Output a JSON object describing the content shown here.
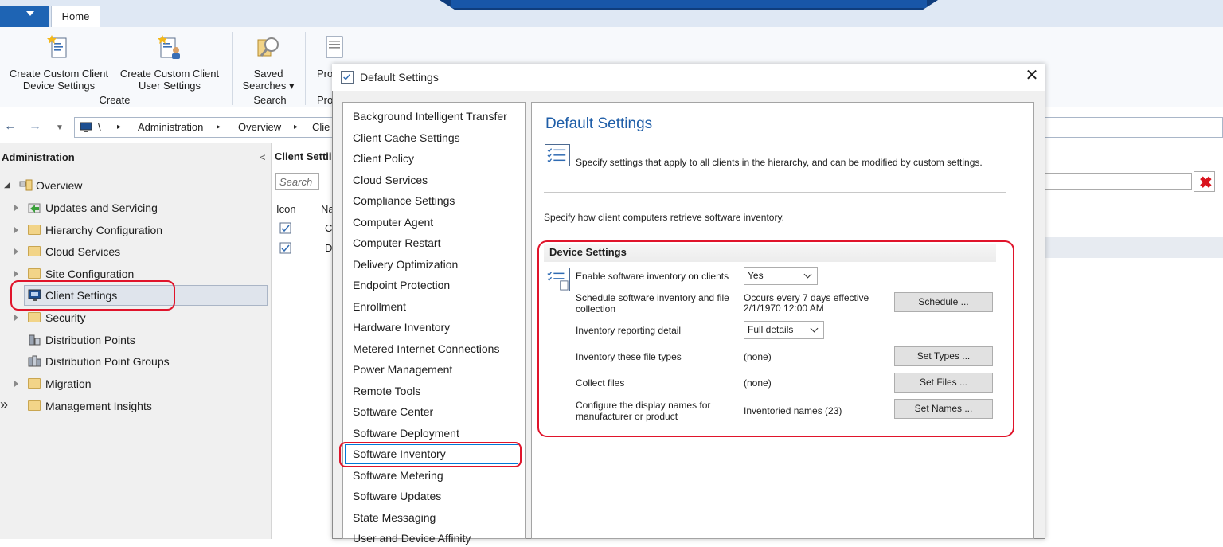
{
  "ribbon": {
    "tab_home": "Home",
    "btn_create_device": [
      "Create Custom Client",
      "Device Settings"
    ],
    "btn_create_user": [
      "Create Custom Client",
      "User Settings"
    ],
    "btn_saved_searches": [
      "Saved",
      "Searches ▾"
    ],
    "btn_pro": "Pro",
    "group_create": "Create",
    "group_search": "Search",
    "group_pro": "Pro"
  },
  "addressbar": {
    "crumbs": [
      "\\",
      "▸",
      "Administration",
      "▸",
      "Overview",
      "▸",
      "Clie"
    ]
  },
  "nav": {
    "title": "Administration",
    "collapse_glyph": "<",
    "items": [
      {
        "label": "Overview",
        "icon": "overview-icon"
      },
      {
        "label": "Updates and Servicing",
        "icon": "updates-icon"
      },
      {
        "label": "Hierarchy Configuration",
        "icon": "folder-icon"
      },
      {
        "label": "Cloud Services",
        "icon": "folder-icon"
      },
      {
        "label": "Site Configuration",
        "icon": "folder-icon"
      },
      {
        "label": "Client Settings",
        "icon": "client-settings-icon"
      },
      {
        "label": "Security",
        "icon": "folder-icon"
      },
      {
        "label": "Distribution Points",
        "icon": "distribution-point-icon"
      },
      {
        "label": "Distribution Point Groups",
        "icon": "distribution-point-group-icon"
      },
      {
        "label": "Migration",
        "icon": "folder-icon"
      },
      {
        "label": "Management Insights",
        "icon": "folder-icon"
      }
    ],
    "expand_glyph": "»"
  },
  "list": {
    "title": "Client Settii",
    "search_placeholder": "Search",
    "col_icon": "Icon",
    "col_name": "Na",
    "rows": [
      {
        "name": "C"
      },
      {
        "name": "D"
      }
    ]
  },
  "dialog": {
    "title": "Default Settings",
    "close_glyph": "✕",
    "categories": [
      "Background Intelligent Transfer",
      "Client Cache Settings",
      "Client Policy",
      "Cloud Services",
      "Compliance Settings",
      "Computer Agent",
      "Computer Restart",
      "Delivery Optimization",
      "Endpoint Protection",
      "Enrollment",
      "Hardware Inventory",
      "Metered Internet Connections",
      "Power Management",
      "Remote Tools",
      "Software Center",
      "Software Deployment",
      "Software Inventory",
      "Software Metering",
      "Software Updates",
      "State Messaging",
      "User and Device Affinity"
    ],
    "selected_category": "Software Inventory",
    "panel": {
      "title": "Default Settings",
      "description": "Specify settings that apply to all clients in the hierarchy, and can be modified by custom settings.",
      "intro": "Specify how client computers retrieve software inventory.",
      "section_title": "Device Settings",
      "fields": {
        "enable_label": "Enable software inventory on clients",
        "enable_value": "Yes",
        "schedule_label_1": "Schedule software inventory and file",
        "schedule_label_2": "collection",
        "schedule_value_1": "Occurs every 7 days effective",
        "schedule_value_2": "2/1/1970 12:00 AM",
        "schedule_button": "Schedule ...",
        "detail_label": "Inventory reporting detail",
        "detail_value": "Full details",
        "filetypes_label": "Inventory these file types",
        "filetypes_value": "(none)",
        "filetypes_button": "Set Types ...",
        "collect_label": "Collect files",
        "collect_value": "(none)",
        "collect_button": "Set Files ...",
        "names_label_1": "Configure the display names for",
        "names_label_2": "manufacturer or product",
        "names_value": "Inventoried names (23)",
        "names_button": "Set Names ..."
      }
    }
  },
  "colors": {
    "accent_blue": "#1f5ea8",
    "highlight_red": "#e0142b",
    "ribbon_bg": "#f7f9fc"
  }
}
